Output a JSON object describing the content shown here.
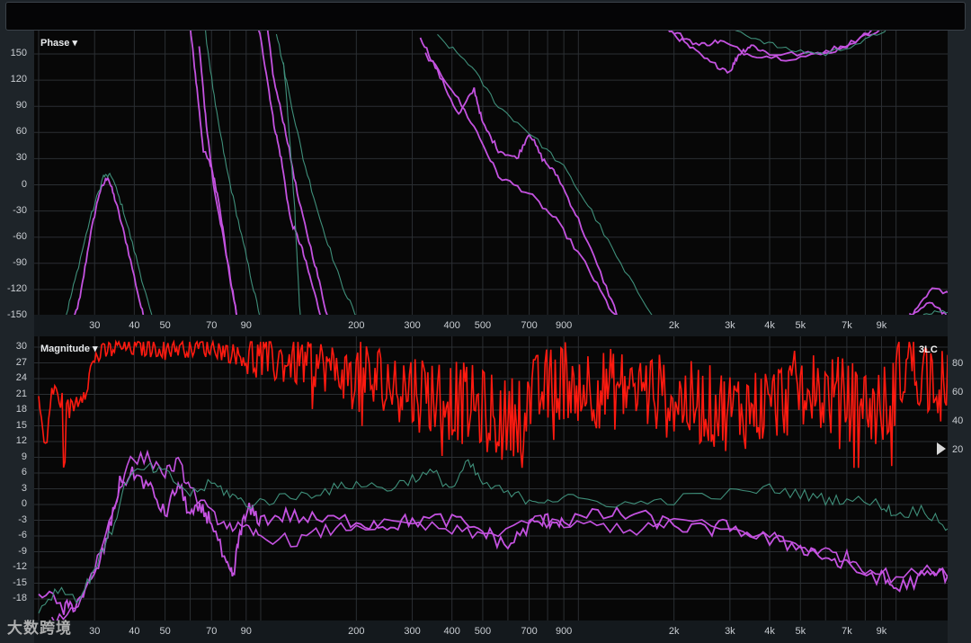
{
  "phase_panel": {
    "title": "Phase ▾",
    "y_ticks": [
      "150",
      "120",
      "90",
      "60",
      "30",
      "0",
      "-30",
      "-60",
      "-90",
      "-120",
      "-150"
    ],
    "x_ticks": [
      "30",
      "40",
      "50",
      "70",
      "90",
      "200",
      "300",
      "400",
      "500",
      "700",
      "900",
      "2k",
      "3k",
      "4k",
      "5k",
      "7k",
      "9k"
    ]
  },
  "magnitude_panel": {
    "title": "Magnitude ▾",
    "badge": "3LC",
    "y_ticks": [
      "30",
      "27",
      "24",
      "21",
      "18",
      "15",
      "12",
      "9",
      "6",
      "3",
      "0",
      "-3",
      "-6",
      "-9",
      "-12",
      "-15",
      "-18"
    ],
    "right_ticks": [
      "80",
      "60",
      "40",
      "20"
    ],
    "x_ticks": [
      "30",
      "40",
      "50",
      "70",
      "90",
      "200",
      "300",
      "400",
      "500",
      "700",
      "900",
      "2k",
      "3k",
      "4k",
      "5k",
      "7k",
      "9k"
    ]
  },
  "colors": {
    "magenta": "#c452e0",
    "green": "#3f8f7a",
    "red": "#ff1a10",
    "grid": "#2b2f33"
  },
  "watermark": "大数跨境"
}
